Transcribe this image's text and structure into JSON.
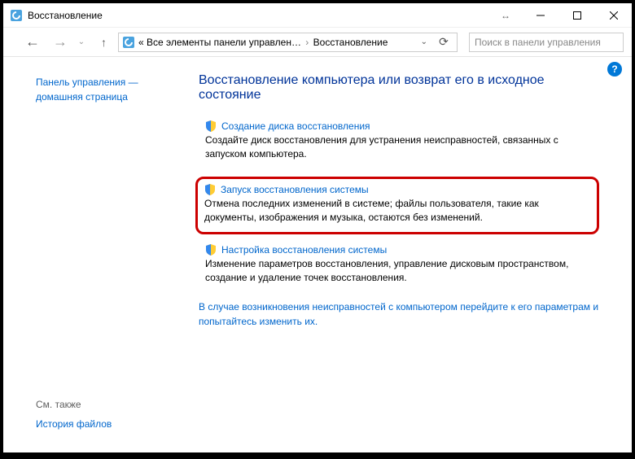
{
  "title": "Восстановление",
  "breadcrumb": {
    "prefix": "«",
    "part1": "Все элементы панели управлен…",
    "part2": "Восстановление"
  },
  "search_placeholder": "Поиск в панели управления",
  "sidebar": {
    "home": "Панель управления — домашняя страница",
    "see_also": "См. также",
    "file_history": "История файлов"
  },
  "main": {
    "heading": "Восстановление компьютера или возврат его в исходное состояние",
    "items": [
      {
        "link": "Создание диска восстановления",
        "desc": "Создайте диск восстановления для устранения неисправностей, связанных с запуском компьютера."
      },
      {
        "link": "Запуск восстановления системы",
        "desc": "Отмена последних изменений в системе; файлы пользователя, такие как документы, изображения и музыка, остаются без изменений."
      },
      {
        "link": "Настройка восстановления системы",
        "desc": "Изменение параметров восстановления, управление дисковым пространством, создание и удаление точек восстановления."
      }
    ],
    "footer_link": "В случае возникновения неисправностей с компьютером перейдите к его параметрам и попытайтесь изменить их."
  }
}
